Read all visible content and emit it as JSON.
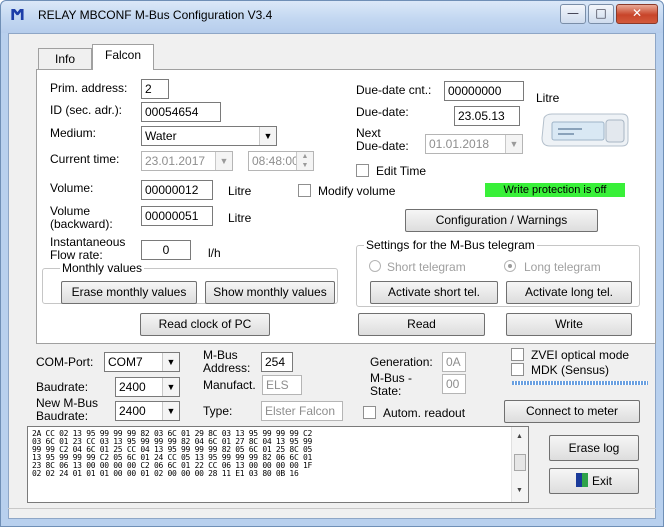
{
  "window": {
    "title": "RELAY MBCONF  M-Bus Configuration  V3.4",
    "app_icon": "Ϻ",
    "controls": [
      "minimize-icon",
      "maximize-icon",
      "close-icon"
    ]
  },
  "tabs": [
    {
      "label": "Info",
      "active": false
    },
    {
      "label": "Falcon",
      "active": true
    }
  ],
  "falcon": {
    "prim_address_label": "Prim. address:",
    "prim_address": "2",
    "id_label": "ID (sec. adr.):",
    "id_value": "00054654",
    "medium_label": "Medium:",
    "medium_value": "Water",
    "current_time_label": "Current time:",
    "current_date": "23.01.2017",
    "current_clock": "08:48:00",
    "volume_label": "Volume:",
    "volume_value": "00000012",
    "volume_unit": "Litre",
    "modify_volume_label": "Modify volume",
    "volume_backward_label_1": "Volume",
    "volume_backward_label_2": "(backward):",
    "volume_backward_value": "00000051",
    "volume_backward_unit": "Litre",
    "flow_label_1": "Instantaneous",
    "flow_label_2": "Flow rate:",
    "flow_value": "0",
    "flow_unit": "l/h",
    "due_cnt_label": "Due-date cnt.:",
    "due_cnt_value": "00000000",
    "due_cnt_unit": "Litre",
    "due_date_label": "Due-date:",
    "due_date_value": "23.05.13",
    "next_due_label_1": "Next",
    "next_due_label_2": "Due-date:",
    "next_due_value": "01.01.2018",
    "edit_time_label": "Edit Time",
    "write_protection": "Write protection is off",
    "config_button": "Configuration / Warnings",
    "monthly_title": "Monthly values",
    "erase_monthly": "Erase monthly values",
    "show_monthly": "Show monthly values",
    "settings_title": "Settings for the M-Bus telegram",
    "short_telegram": "Short telegram",
    "long_telegram": "Long telegram",
    "activate_short": "Activate short tel.",
    "activate_long": "Activate long tel.",
    "read_clock": "Read clock of PC",
    "read": "Read",
    "write": "Write"
  },
  "bottom": {
    "com_port_label": "COM-Port:",
    "com_port_value": "COM7",
    "baudrate_label": "Baudrate:",
    "baudrate_value": "2400",
    "new_baud_label_1": "New M-Bus",
    "new_baud_label_2": "Baudrate:",
    "new_baud_value": "2400",
    "mbus_address_label_1": "M-Bus",
    "mbus_address_label_2": "Address:",
    "mbus_address_value": "254",
    "manufact_label": "Manufact.",
    "manufact_value": "ELS",
    "type_label": "Type:",
    "type_value": "Elster Falcon",
    "generation_label": "Generation:",
    "generation_value": "0A",
    "mbus_state_label_1": "M-Bus -",
    "mbus_state_label_2": "State:",
    "mbus_state_value": "00",
    "zvei_label": "ZVEI optical mode",
    "mdk_label": "MDK (Sensus)",
    "auto_readout_label": "Autom. readout",
    "connect_button": "Connect to meter",
    "erase_log": "Erase log",
    "exit": "Exit"
  },
  "log_lines": [
    "2A CC 02 13 95 99 99 99 82 03 6C 01 29 8C 03 13 95 99 99 99 C2",
    "03 6C 01 23 CC 03 13 95 99 99 99 82 04 6C 01 27 8C 04 13 95 99",
    "99 99 C2 04 6C 01 25 CC 04 13 95 99 99 99 82 05 6C 01 25 8C 05",
    "13 95 99 99 99 C2 05 6C 01 24 CC 05 13 95 99 99 99 82 06 6C 01",
    "23 8C 06 13 00 00 00 00 C2 06 6C 01 22 CC 06 13 00 00 00 00 1F",
    "02 02 24 01 01 01 00 00 01 02 00 00 00 28 11 E1 03 80 0B 16"
  ],
  "colors": {
    "write_protection_bg": "#39f039",
    "window_frame": "#b8d0ee",
    "tab_border": "#a0a0a0"
  }
}
